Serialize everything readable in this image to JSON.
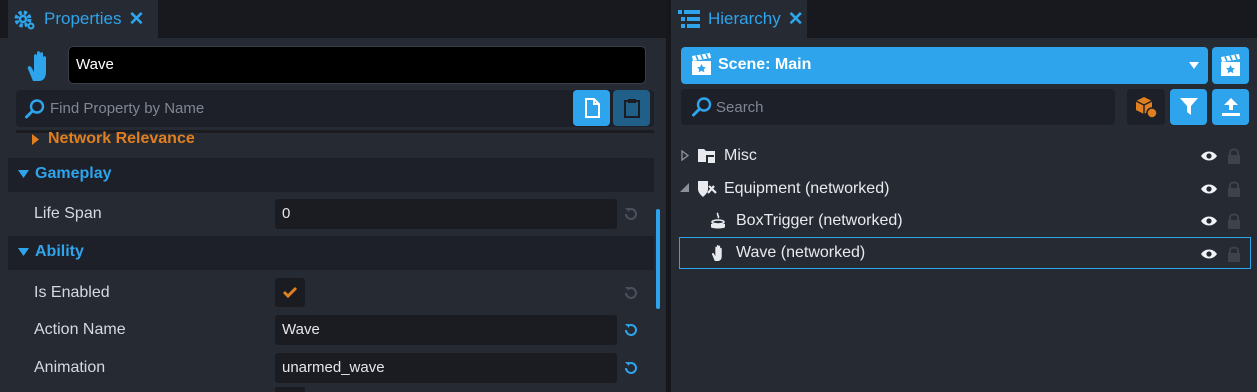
{
  "properties": {
    "tab_title": "Properties",
    "tab_close": "✕",
    "object_name": "Wave",
    "find_placeholder": "Find Property by Name",
    "sections": {
      "network_relevance": {
        "label": "Network Relevance",
        "color": "#e07f1f"
      },
      "gameplay": {
        "label": "Gameplay",
        "color": "#2ea4ec"
      },
      "ability": {
        "label": "Ability",
        "color": "#2ea4ec"
      }
    },
    "fields": {
      "life_span": {
        "label": "Life Span",
        "value": "0"
      },
      "is_enabled": {
        "label": "Is Enabled",
        "checked": true
      },
      "action_name": {
        "label": "Action Name",
        "value": "Wave"
      },
      "animation": {
        "label": "Animation",
        "value": "unarmed_wave"
      }
    }
  },
  "hierarchy": {
    "tab_title": "Hierarchy",
    "tab_close": "✕",
    "scene_label": "Scene: Main",
    "search_placeholder": "Search",
    "items": [
      {
        "label": "Misc",
        "icon": "folder-icon"
      },
      {
        "label": "Equipment (networked)",
        "icon": "equipment-icon"
      },
      {
        "label": "BoxTrigger (networked)",
        "icon": "trigger-icon"
      },
      {
        "label": "Wave (networked)",
        "icon": "hand-icon",
        "selected": true
      }
    ]
  },
  "colors": {
    "accent": "#2ea4ec",
    "orange": "#e07f1f",
    "panel": "#262a33",
    "background": "#1b1d24"
  }
}
